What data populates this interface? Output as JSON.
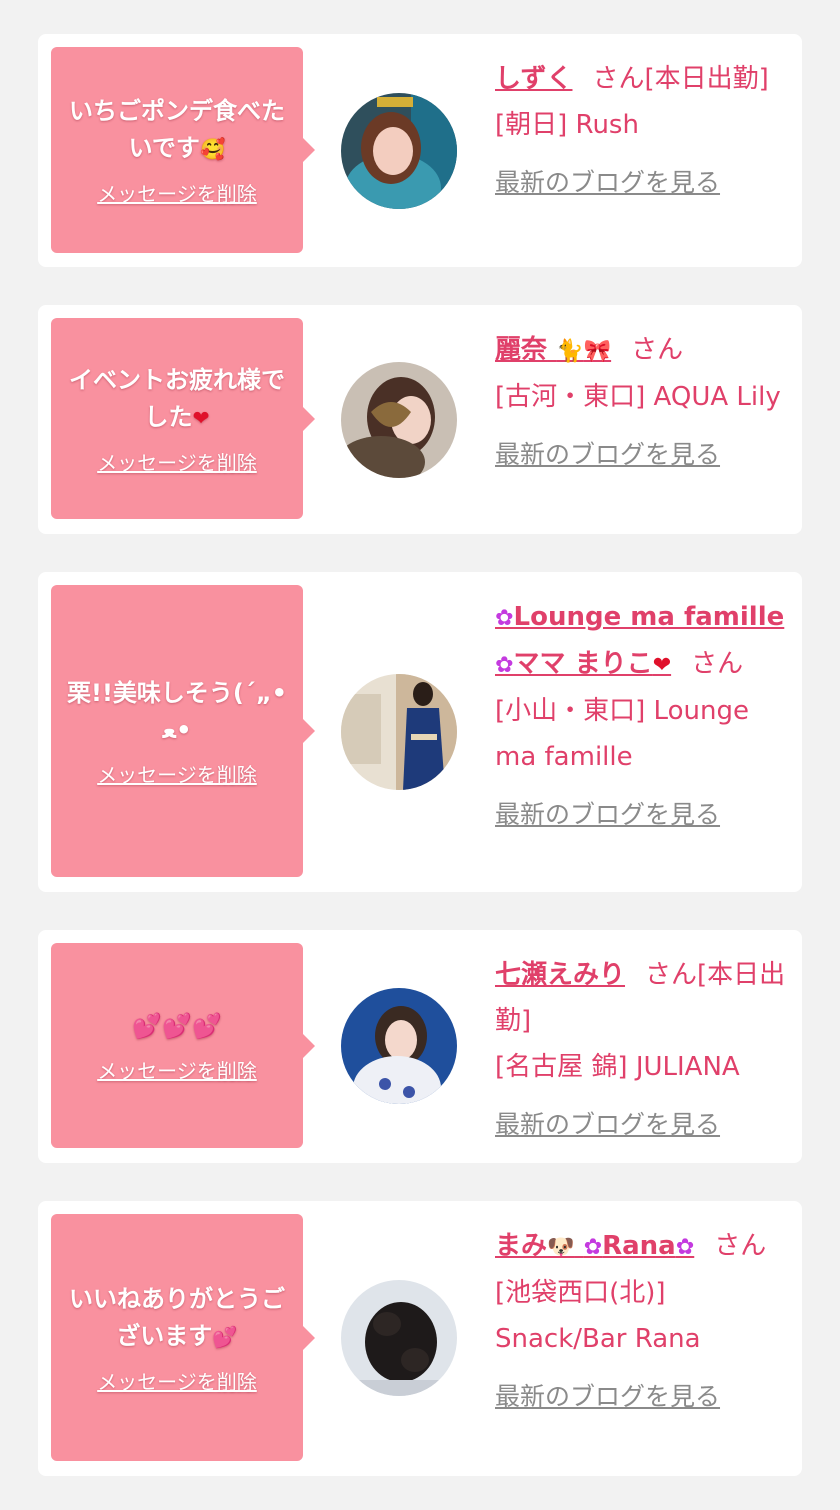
{
  "cards": [
    {
      "message": "いちごポンデ食べたいです",
      "message_emoji": "🥰",
      "delete_label": "メッセージを削除",
      "name": "しずく",
      "san": "さん[本日出勤]",
      "area": "[朝日] Rush",
      "blog_label": "最新のブログを見る"
    },
    {
      "message": "イベントお疲れ様でした",
      "message_emoji": "❤",
      "delete_label": "メッセージを削除",
      "name": "麗奈",
      "name_icons": [
        "🐈",
        "🎀"
      ],
      "san": "さん",
      "area": "[古河・東口] AQUA Lily",
      "blog_label": "最新のブログを見る"
    },
    {
      "message": "栗!!美味しそう(´„• ﻌ•",
      "delete_label": "メッセージを削除",
      "name_parts": [
        "Lounge ma famille",
        "ママ まりこ"
      ],
      "name_icons": [
        "✿",
        "✿",
        "❤"
      ],
      "san": "さん",
      "area": "[小山・東口] Lounge ma famille",
      "blog_label": "最新のブログを見る"
    },
    {
      "message": "💕💕💕",
      "delete_label": "メッセージを削除",
      "name": "七瀬えみり",
      "san": "さん[本日出勤]",
      "area": "[名古屋 錦] JULIANA",
      "blog_label": "最新のブログを見る"
    },
    {
      "message": "いいねありがとうございます",
      "message_emoji": "💕",
      "delete_label": "メッセージを削除",
      "name_parts": [
        "まみ",
        "Rana"
      ],
      "name_icons": [
        "🐶",
        "✿",
        "✿"
      ],
      "san": "さん",
      "area": "[池袋西口(北)] Snack/Bar Rana",
      "blog_label": "最新のブログを見る"
    }
  ],
  "colors": {
    "background": "#f2f2f2",
    "card": "#ffffff",
    "bubble": "#f9919f",
    "accent": "#e0406a",
    "link_gray": "#8a8a8a"
  }
}
